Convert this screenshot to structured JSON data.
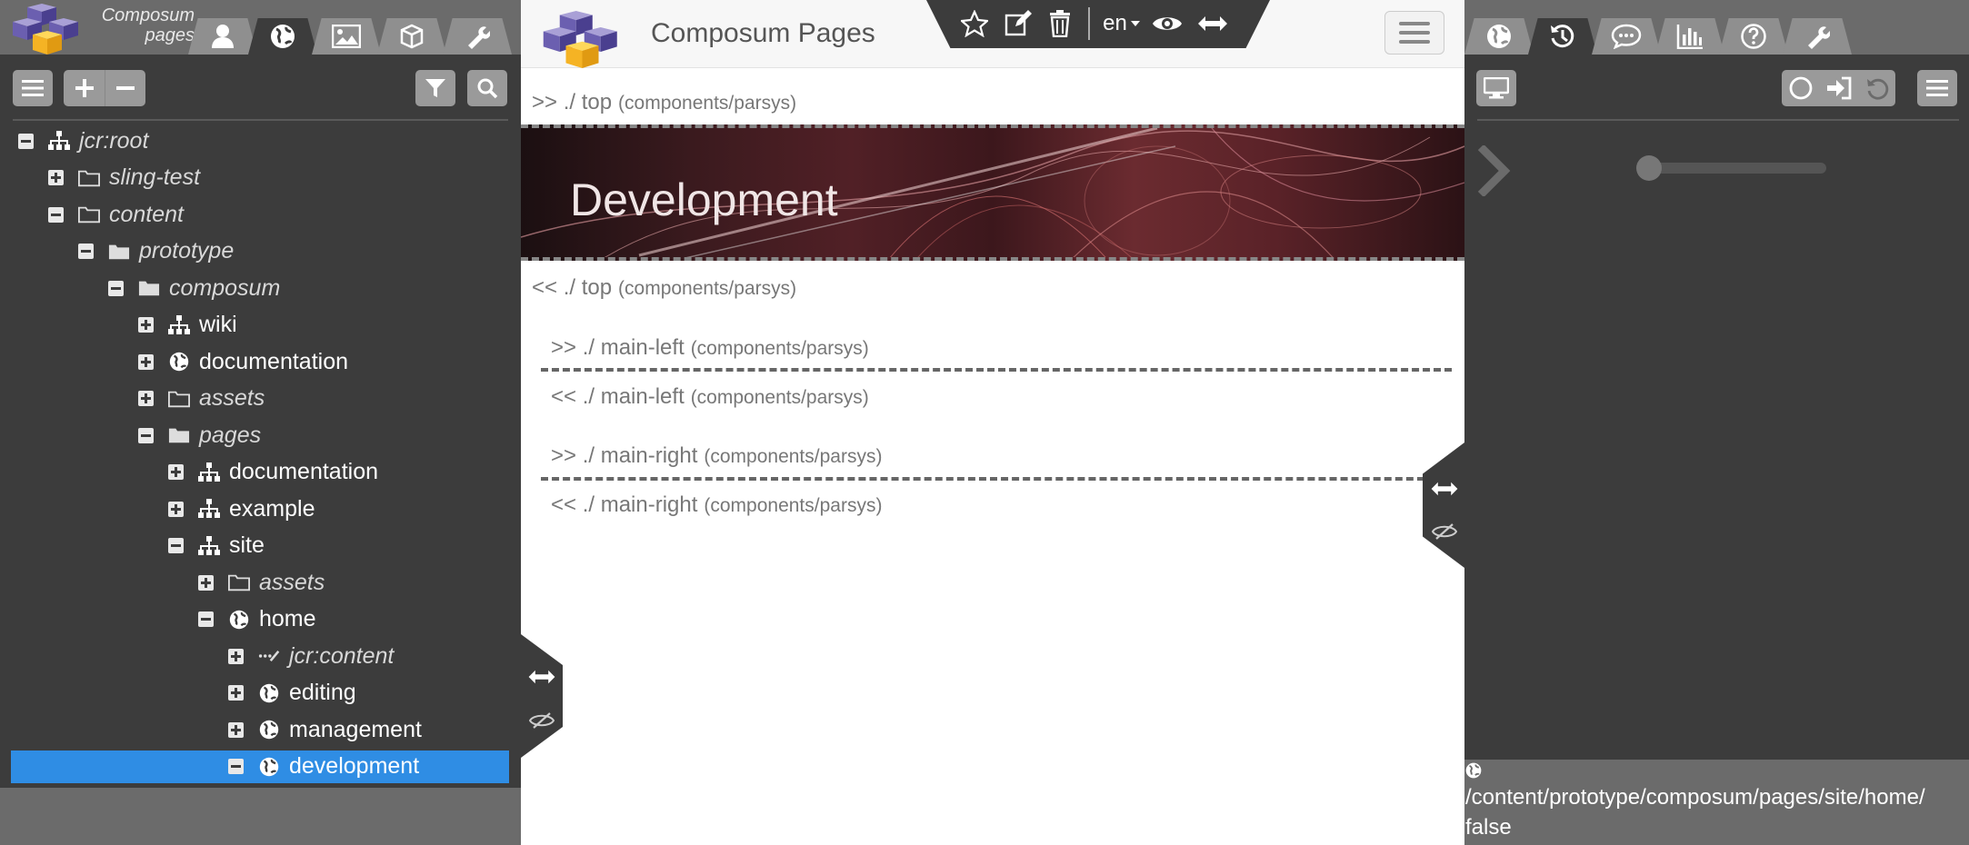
{
  "app": {
    "logo_line1": "Composum",
    "logo_line2": "pages",
    "title": "Composum Pages"
  },
  "left_tabs": [
    {
      "icon": "user-icon",
      "active": false
    },
    {
      "icon": "globe-icon",
      "active": true
    },
    {
      "icon": "image-icon",
      "active": false
    },
    {
      "icon": "cube-icon",
      "active": false
    },
    {
      "icon": "wrench-icon",
      "active": false
    }
  ],
  "tree": [
    {
      "label": "jcr:root",
      "level": 0,
      "icon": "sitemap-icon",
      "expanded": true,
      "italic": true
    },
    {
      "label": "sling-test",
      "level": 1,
      "icon": "folder-outline-icon",
      "expanded": false,
      "italic": true
    },
    {
      "label": "content",
      "level": 1,
      "icon": "folder-outline-icon",
      "expanded": true,
      "italic": true
    },
    {
      "label": "prototype",
      "level": 2,
      "icon": "folder-icon",
      "expanded": true,
      "italic": true
    },
    {
      "label": "composum",
      "level": 3,
      "icon": "folder-icon",
      "expanded": true,
      "italic": true
    },
    {
      "label": "wiki",
      "level": 4,
      "icon": "sitemap-icon",
      "expanded": false,
      "italic": false
    },
    {
      "label": "documentation",
      "level": 4,
      "icon": "globe-icon",
      "expanded": false,
      "italic": false
    },
    {
      "label": "assets",
      "level": 4,
      "icon": "folder-outline-icon",
      "expanded": false,
      "italic": true
    },
    {
      "label": "pages",
      "level": 4,
      "icon": "folder-icon",
      "expanded": true,
      "italic": true
    },
    {
      "label": "documentation",
      "level": 5,
      "icon": "sitemap-icon",
      "expanded": false,
      "italic": false
    },
    {
      "label": "example",
      "level": 5,
      "icon": "sitemap-icon",
      "expanded": false,
      "italic": false
    },
    {
      "label": "site",
      "level": 5,
      "icon": "sitemap-icon",
      "expanded": true,
      "italic": false
    },
    {
      "label": "assets",
      "level": 6,
      "icon": "folder-outline-icon",
      "expanded": false,
      "italic": true
    },
    {
      "label": "home",
      "level": 6,
      "icon": "globe-icon",
      "expanded": true,
      "italic": false
    },
    {
      "label": "jcr:content",
      "level": 7,
      "icon": "content-icon",
      "expanded": false,
      "italic": true
    },
    {
      "label": "editing",
      "level": 7,
      "icon": "globe-icon",
      "expanded": false,
      "italic": false
    },
    {
      "label": "management",
      "level": 7,
      "icon": "globe-icon",
      "expanded": false,
      "italic": false
    },
    {
      "label": "development",
      "level": 7,
      "icon": "globe-icon",
      "expanded": true,
      "italic": false,
      "selected": true
    }
  ],
  "toolbar": {
    "language": "en"
  },
  "page": {
    "top_open": ">> ./ top",
    "top_type": "(components/parsys)",
    "banner_title": "Development",
    "top_close": "<< ./ top",
    "main_left_open": ">> ./ main-left",
    "main_left_close": "<< ./ main-left",
    "main_right_open": ">> ./ main-right",
    "main_right_close": "<< ./ main-right",
    "parsys_type": "(components/parsys)"
  },
  "right_tabs": [
    {
      "icon": "globe-icon",
      "active": false
    },
    {
      "icon": "history-icon",
      "active": true
    },
    {
      "icon": "comments-icon",
      "active": false
    },
    {
      "icon": "bar-chart-icon",
      "active": false
    },
    {
      "icon": "question-icon",
      "active": false
    },
    {
      "icon": "wrench-icon",
      "active": false
    }
  ],
  "status": {
    "path": "/content/prototype/composum/pages/site/home/",
    "value": "false"
  }
}
